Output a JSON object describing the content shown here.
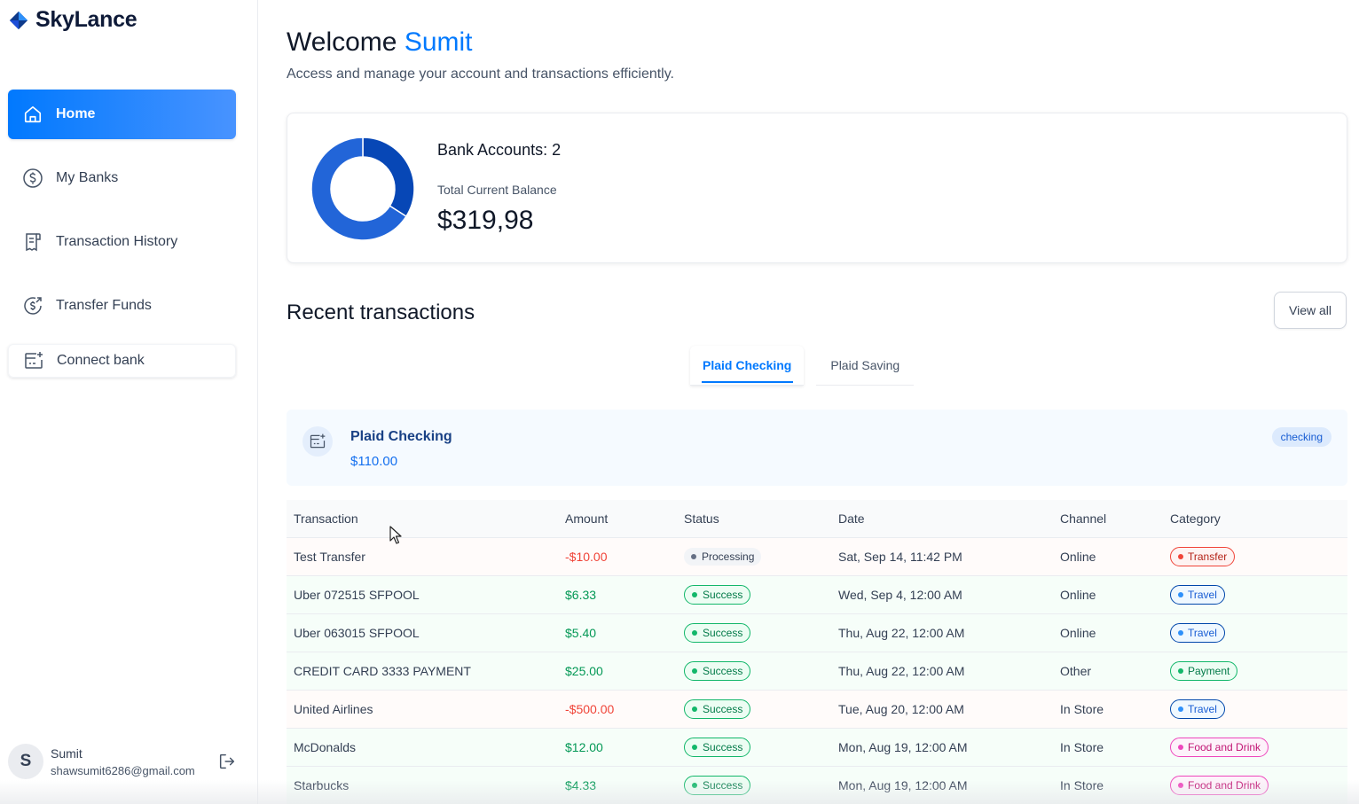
{
  "app": {
    "name": "SkyLance"
  },
  "sidebar": {
    "items": [
      {
        "label": "Home",
        "icon": "home-icon",
        "active": true
      },
      {
        "label": "My Banks",
        "icon": "dollar-circle-icon",
        "active": false
      },
      {
        "label": "Transaction History",
        "icon": "receipt-icon",
        "active": false
      },
      {
        "label": "Transfer Funds",
        "icon": "money-send-icon",
        "active": false
      },
      {
        "label": "Connect bank",
        "icon": "connect-bank-icon",
        "active": false
      }
    ],
    "user": {
      "initial": "S",
      "name": "Sumit",
      "email": "shawsumit6286@gmail.com"
    }
  },
  "header": {
    "welcome": "Welcome",
    "user_name": "Sumit",
    "subtitle": "Access and manage your account and transactions efficiently."
  },
  "balance": {
    "bank_accounts_label": "Bank Accounts: 2",
    "total_label": "Total Current Balance",
    "total_value": "$319,98",
    "donut_share": [
      0.34,
      0.66
    ],
    "donut_colors": [
      "#0747b6",
      "#2265d8"
    ]
  },
  "recent": {
    "title": "Recent transactions",
    "view_all": "View all",
    "tabs": [
      {
        "label": "Plaid Checking",
        "active": true
      },
      {
        "label": "Plaid Saving",
        "active": false
      }
    ],
    "account": {
      "name": "Plaid Checking",
      "amount": "$110.00",
      "type": "checking"
    },
    "columns": [
      "Transaction",
      "Amount",
      "Status",
      "Date",
      "Channel",
      "Category"
    ],
    "rows": [
      {
        "name": "Test Transfer",
        "amount": "-$10.00",
        "sign": "neg",
        "status": "Processing",
        "date": "Sat, Sep 14, 11:42 PM",
        "channel": "Online",
        "category": "Transfer"
      },
      {
        "name": "Uber 072515 SFPOOL",
        "amount": "$6.33",
        "sign": "pos",
        "status": "Success",
        "date": "Wed, Sep 4, 12:00 AM",
        "channel": "Online",
        "category": "Travel"
      },
      {
        "name": "Uber 063015 SFPOOL",
        "amount": "$5.40",
        "sign": "pos",
        "status": "Success",
        "date": "Thu, Aug 22, 12:00 AM",
        "channel": "Online",
        "category": "Travel"
      },
      {
        "name": "CREDIT CARD 3333 PAYMENT",
        "amount": "$25.00",
        "sign": "pos",
        "status": "Success",
        "date": "Thu, Aug 22, 12:00 AM",
        "channel": "Other",
        "category": "Payment"
      },
      {
        "name": "United Airlines",
        "amount": "-$500.00",
        "sign": "neg",
        "status": "Success",
        "date": "Tue, Aug 20, 12:00 AM",
        "channel": "In Store",
        "category": "Travel"
      },
      {
        "name": "McDonalds",
        "amount": "$12.00",
        "sign": "pos",
        "status": "Success",
        "date": "Mon, Aug 19, 12:00 AM",
        "channel": "In Store",
        "category": "Food and Drink"
      },
      {
        "name": "Starbucks",
        "amount": "$4.33",
        "sign": "pos",
        "status": "Success",
        "date": "Mon, Aug 19, 12:00 AM",
        "channel": "In Store",
        "category": "Food and Drink"
      }
    ]
  }
}
